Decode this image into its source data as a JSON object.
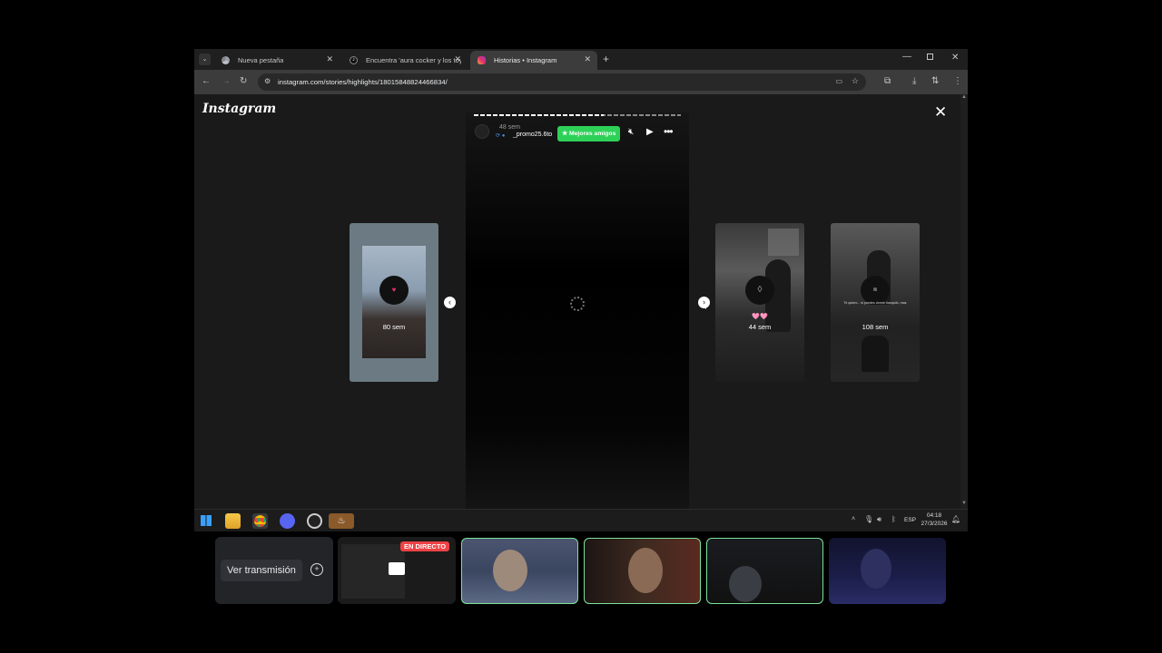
{
  "browser": {
    "tabs": [
      {
        "label": "Nueva pestaña",
        "active": false,
        "icon": "chrome-icon"
      },
      {
        "label": "Encuentra 'aura cocker y los toy",
        "active": false,
        "icon": "tiktok-icon"
      },
      {
        "label": "Historias • Instagram",
        "active": true,
        "icon": "instagram-icon"
      }
    ],
    "new_tab": "+",
    "url": "instagram.com/stories/highlights/18015848824466834/"
  },
  "instagram": {
    "logo": "Instagram",
    "story": {
      "time": "48 sem",
      "username": "_promo25.6to",
      "badge": "★ Mejores amigos"
    },
    "left_preview": {
      "time": "80 sem",
      "emoji": "♥"
    },
    "right_previews": [
      {
        "time": "44 sem",
        "emoji": "🩷🩷"
      },
      {
        "time": "108 sem",
        "caption": "Te quiero... si puedes dormir tranquilo, mas"
      }
    ]
  },
  "taskbar": {
    "language": "ESP",
    "time": "04:18",
    "date": "27/3/2026"
  },
  "call": {
    "watch_button": "Ver transmisión",
    "live_badge": "EN DIRECTO"
  },
  "colors": {
    "accent_green": "#2ed158",
    "live_red": "#ed4245",
    "speaking": "#7ce29a"
  }
}
